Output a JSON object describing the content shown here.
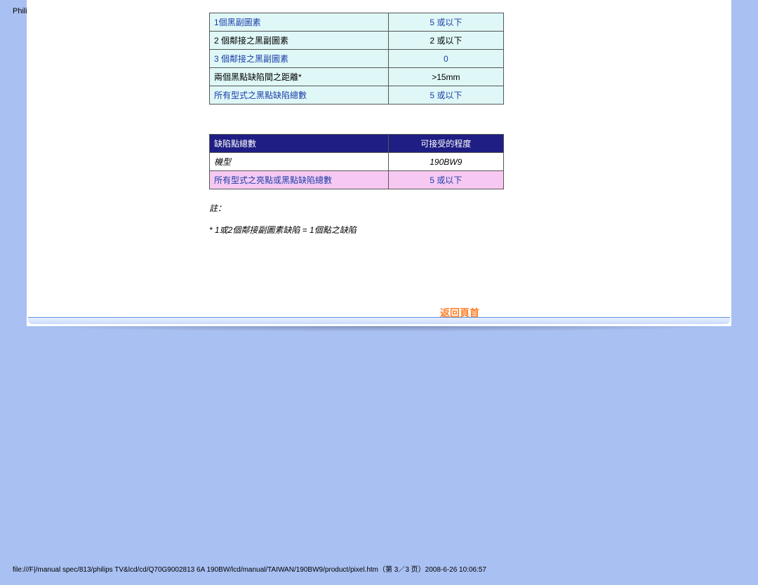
{
  "page_header": "Philips Pixel Defect Policy",
  "table1": {
    "rows": [
      {
        "left": "1個黑副圖素",
        "right": "5 或以下",
        "cls": "r-blue"
      },
      {
        "left": "2 個鄰接之黑副圖素",
        "right": "2 或以下",
        "cls": "r-blk"
      },
      {
        "left": "3 個鄰接之黑副圖素",
        "right": "0",
        "cls": "r-blue"
      },
      {
        "left": "兩個黑點缺陷間之距離*",
        "right": ">15mm",
        "cls": "r-blk"
      },
      {
        "left": "所有型式之黑點缺陷總數",
        "right": "5 或以下",
        "cls": "r-blue"
      }
    ]
  },
  "table2": {
    "header": {
      "left": "缺陷點總數",
      "right": "可接受的程度"
    },
    "rows": [
      {
        "left": "機型",
        "right": "190BW9",
        "cls": "r-model"
      },
      {
        "left": "所有型式之亮點或黑點缺陷總數",
        "right": "5 或以下",
        "cls": "r-pink"
      }
    ]
  },
  "notes": {
    "line1": "註：",
    "line2": "* 1或2個鄰接副圖素缺陷 = 1個點之缺陷"
  },
  "back_to_top": "返回頁首",
  "footer_path": "file:///F|/manual spec/813/philips TV&lcd/cd/Q70G9002813 6A 190BW/lcd/manual/TAIWAN/190BW9/product/pixel.htm（第 3／3 页）2008-6-26 10:06:57"
}
